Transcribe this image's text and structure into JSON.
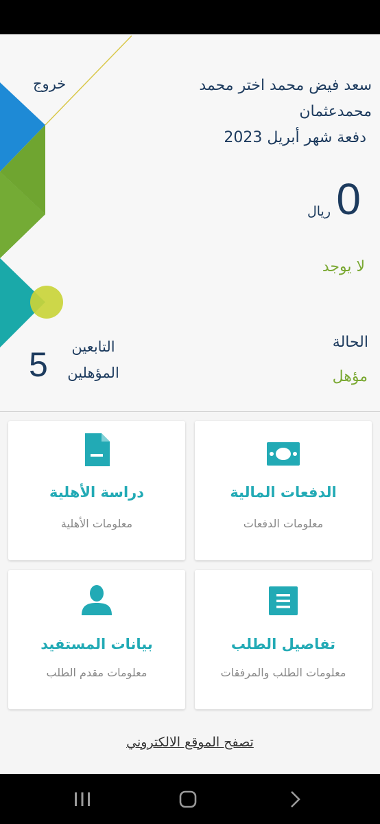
{
  "header": {
    "logout_label": "خروج",
    "beneficiary_name": "سعد فيض محمد اختر محمد محمدعثمان",
    "payment_month": "دفعة شهر أبريل 2023",
    "amount_value": "0",
    "amount_currency": "ريال",
    "amount_note": "لا يوجد",
    "status_label": "الحالة",
    "status_value": "مؤهل",
    "dependents_label": "التابعين المؤهلين",
    "dependents_value": "5"
  },
  "cards": [
    {
      "title": "الدفعات المالية",
      "subtitle": "معلومات الدفعات",
      "icon": "money-icon"
    },
    {
      "title": "دراسة الأهلية",
      "subtitle": "معلومات الأهلية",
      "icon": "document-icon"
    },
    {
      "title": "تفاصيل الطلب",
      "subtitle": "معلومات الطلب والمرفقات",
      "icon": "list-icon"
    },
    {
      "title": "بيانات المستفيد",
      "subtitle": "معلومات مقدم الطلب",
      "icon": "person-icon"
    }
  ],
  "footer": {
    "browse_link": "تصفح الموقع الالكتروني"
  },
  "colors": {
    "primary_text": "#1d3b5e",
    "accent_teal": "#22aab5",
    "accent_green": "#7aa832"
  },
  "navigation": {
    "recents": "recents-icon",
    "home": "home-icon",
    "back": "back-icon"
  }
}
